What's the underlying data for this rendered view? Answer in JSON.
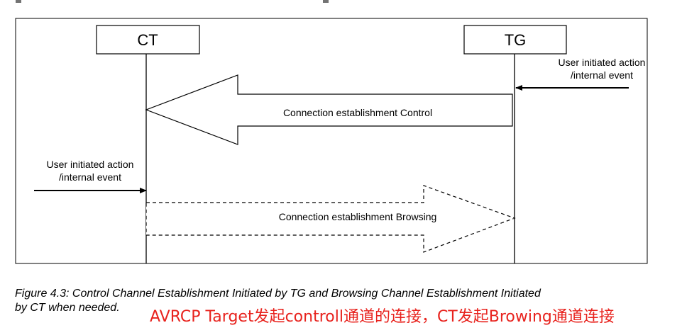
{
  "diagram": {
    "ct_label": "CT",
    "tg_label": "TG",
    "tg_event_line1": "User initiated action",
    "tg_event_line2": "/internal event",
    "ct_event_line1": "User initiated action",
    "ct_event_line2": "/internal event",
    "control_arrow_label": "Connection establishment Control",
    "browsing_arrow_label": "Connection establishment Browsing"
  },
  "caption": {
    "line1": "Figure 4.3: Control Channel Establishment Initiated by TG and Browsing Channel Establishment Initiated",
    "line2": "by CT when needed."
  },
  "note": {
    "text": "AVRCP Target发起controll通道的连接，CT发起Browing通道连接",
    "color": "#e8231e"
  }
}
